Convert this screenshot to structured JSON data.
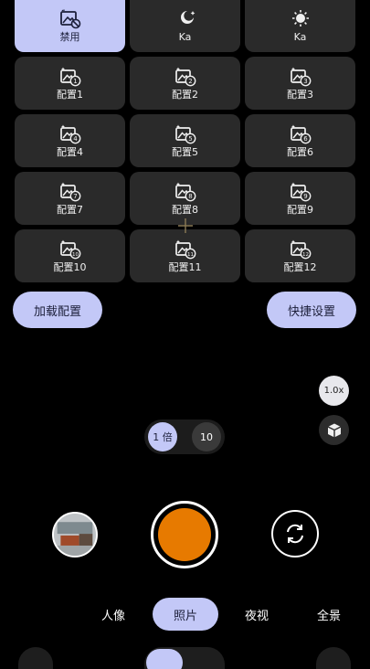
{
  "tiles": [
    {
      "label": "禁用",
      "icon": "image-disabled-icon"
    },
    {
      "label": "Ka",
      "icon": "moon-ka-icon"
    },
    {
      "label": "Ka",
      "icon": "sun-ka-icon"
    },
    {
      "label": "配置1",
      "icon": "preset-1-icon",
      "num": "1"
    },
    {
      "label": "配置2",
      "icon": "preset-2-icon",
      "num": "2"
    },
    {
      "label": "配置3",
      "icon": "preset-3-icon",
      "num": "3"
    },
    {
      "label": "配置4",
      "icon": "preset-4-icon",
      "num": "4"
    },
    {
      "label": "配置5",
      "icon": "preset-5-icon",
      "num": "5"
    },
    {
      "label": "配置6",
      "icon": "preset-6-icon",
      "num": "6"
    },
    {
      "label": "配置7",
      "icon": "preset-7-icon",
      "num": "7"
    },
    {
      "label": "配置8",
      "icon": "preset-8-icon",
      "num": "8"
    },
    {
      "label": "配置9",
      "icon": "preset-9-icon",
      "num": "9"
    },
    {
      "label": "配置10",
      "icon": "preset-10-icon",
      "num": "10"
    },
    {
      "label": "配置11",
      "icon": "preset-11-icon",
      "num": "11"
    },
    {
      "label": "配置12",
      "icon": "preset-12-icon",
      "num": "12"
    }
  ],
  "buttons": {
    "load": "加载配置",
    "quick": "快捷设置"
  },
  "zoom_indicator": "1.0x",
  "zoom": {
    "x1": "1 倍",
    "x10": "10"
  },
  "modes": [
    "人像",
    "照片",
    "夜视",
    "全景"
  ],
  "active_mode": "照片",
  "colors": {
    "accent": "#c3c8f7",
    "shutter": "#e77a00",
    "tile": "#2a2a2a"
  }
}
